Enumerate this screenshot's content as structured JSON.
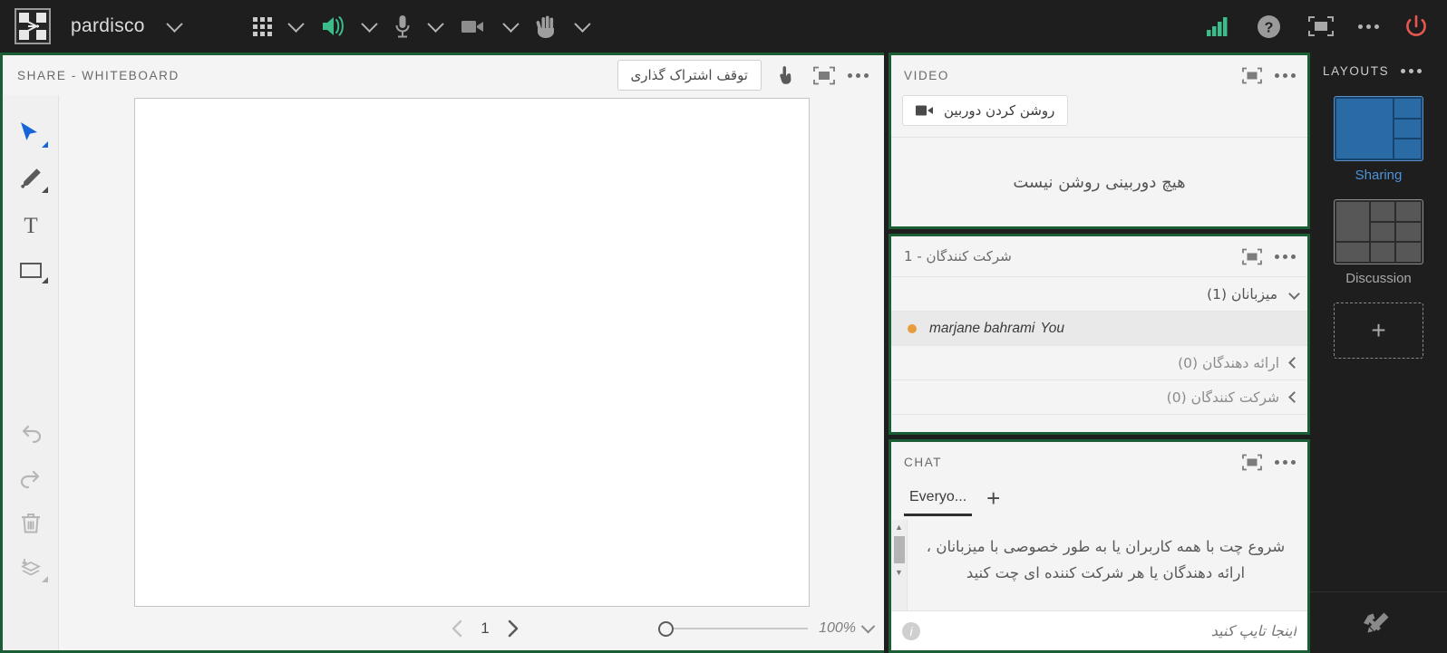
{
  "topbar": {
    "logo_icon": "pardisco-logo-icon",
    "app_name": "pardisco",
    "icons": {
      "grid": "grid-apps-icon",
      "speaker": "speaker-icon",
      "microphone": "microphone-icon",
      "camera": "camera-icon",
      "hand": "raise-hand-icon",
      "signal": "connection-signal-icon",
      "help": "help-icon",
      "fullscreen": "fullscreen-icon",
      "more": "more-options-icon",
      "power": "power-leave-icon"
    }
  },
  "whiteboard": {
    "title": "SHARE - WHITEBOARD",
    "stop_share_label": "توقف اشتراک گذاری",
    "page_number": "1",
    "zoom_level": "100%",
    "tools": [
      {
        "name": "cursor-tool",
        "selected": true
      },
      {
        "name": "pencil-tool",
        "selected": false
      },
      {
        "name": "text-tool",
        "selected": false
      },
      {
        "name": "rectangle-tool",
        "selected": false
      },
      {
        "name": "undo-tool",
        "selected": false
      },
      {
        "name": "redo-tool",
        "selected": false
      },
      {
        "name": "delete-tool",
        "selected": false
      },
      {
        "name": "layers-tool",
        "selected": false
      }
    ]
  },
  "video": {
    "title": "VIDEO",
    "turn_on_camera_label": "روشن کردن دوربین",
    "no_camera_message": "هیچ دوربینی روشن نیست"
  },
  "participants": {
    "title": "شرکت کنندگان  - 1",
    "groups": [
      {
        "label": "میزبانان (1)",
        "expanded": true
      },
      {
        "label": "ارائه دهندگان (0)",
        "expanded": false
      },
      {
        "label": "شرکت کنندگان (0)",
        "expanded": false
      }
    ],
    "user": {
      "name": "marjane bahrami",
      "you_label": "You",
      "status_color": "#e89c3c"
    }
  },
  "chat": {
    "title": "CHAT",
    "tab_label": "Everyo...",
    "add_tab_label": "+",
    "empty_message": "شروع چت با همه کاربران یا به طور خصوصی با میزبانان ، ارائه دهندگان یا هر شرکت کننده ای چت کنید",
    "input_placeholder": "اینجا تایپ کنید"
  },
  "layouts": {
    "title": "LAYOUTS",
    "items": [
      {
        "label": "Sharing",
        "active": true
      },
      {
        "label": "Discussion",
        "active": false
      }
    ],
    "add_label": "+",
    "accent_color": "#4e93d8",
    "tools_icon": "tools-settings-icon"
  },
  "theme": {
    "panel_border": "#1b5e35",
    "topbar_bg": "#1e1e1e",
    "panel_bg": "#f4f4f4"
  }
}
